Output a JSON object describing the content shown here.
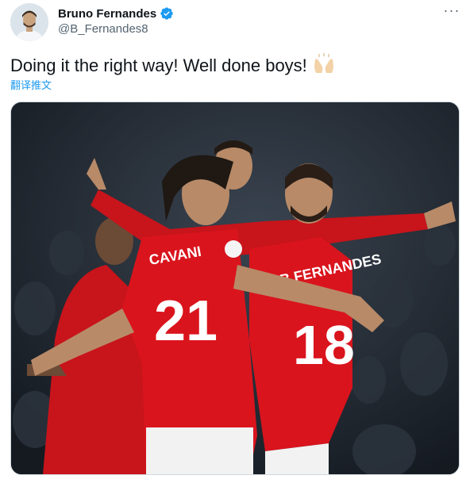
{
  "author": {
    "display_name": "Bruno Fernandes",
    "handle": "@B_Fernandes8",
    "verified": true,
    "avatar_icon": "profile-avatar"
  },
  "tweet": {
    "text": "Doing it the right way! Well done boys!",
    "emoji_icon": "raising-hands-emoji",
    "translate_label": "翻译推文"
  },
  "menu": {
    "more_label": "···"
  },
  "media": {
    "type": "photo",
    "jersey_names": [
      "CAVANI",
      "B.FERNANDES"
    ],
    "jersey_numbers": [
      "21",
      "18"
    ],
    "colors": {
      "kit_red": "#d9141d",
      "background": "#1b2129"
    }
  },
  "colors": {
    "link": "#1d9bf0",
    "secondary_text": "#536471",
    "verified_badge": "#1d9bf0"
  }
}
